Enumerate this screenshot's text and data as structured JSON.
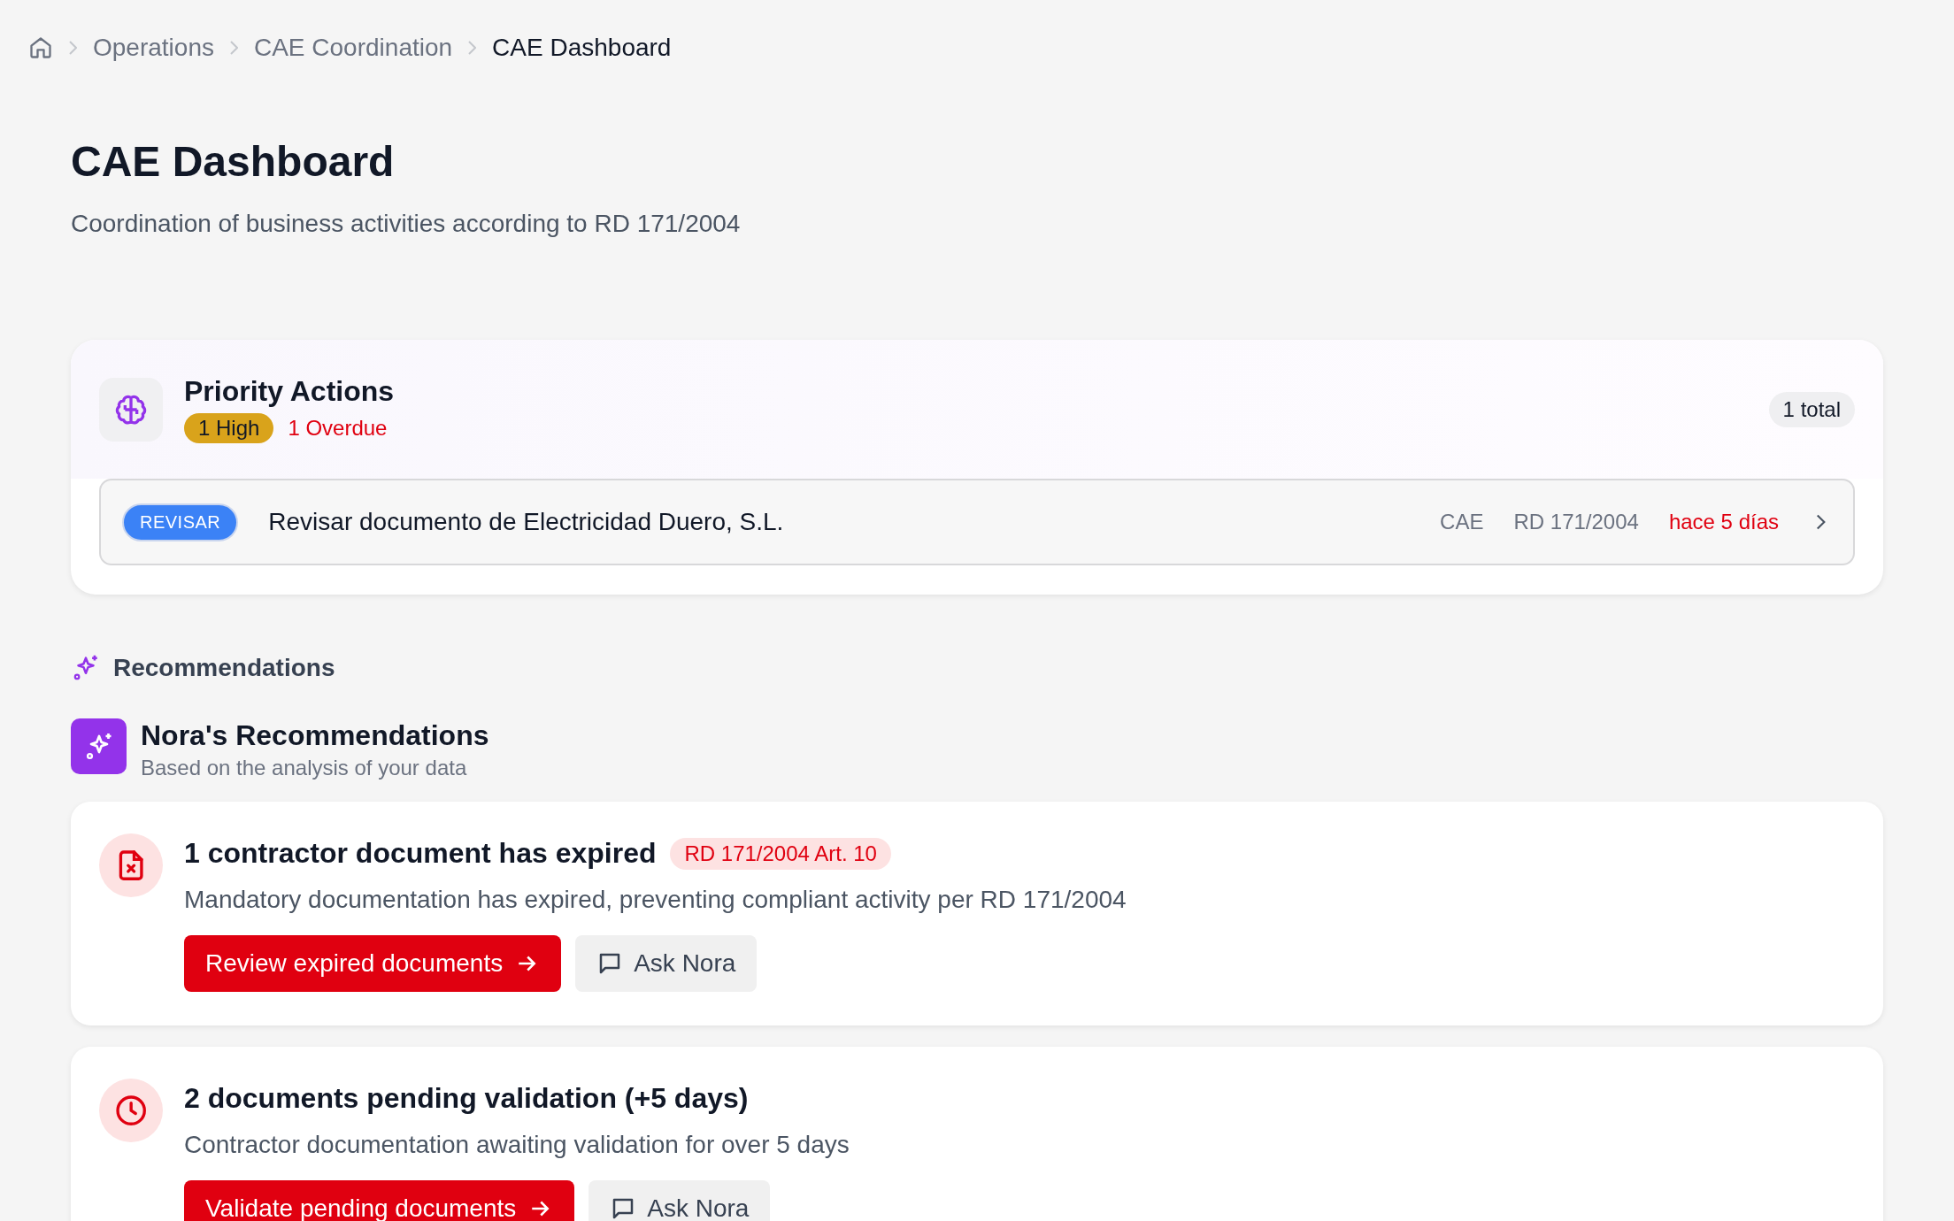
{
  "breadcrumb": [
    {
      "label": "Operations",
      "current": false
    },
    {
      "label": "CAE Coordination",
      "current": false
    },
    {
      "label": "CAE Dashboard",
      "current": true
    }
  ],
  "page": {
    "title": "CAE Dashboard",
    "subtitle": "Coordination of business activities according to RD 171/2004"
  },
  "priority_actions": {
    "title": "Priority Actions",
    "total": "1 total",
    "badges": [
      {
        "kind": "high",
        "text": "1 High"
      },
      {
        "kind": "overdue",
        "text": "1 Overdue"
      }
    ],
    "items": [
      {
        "tag": "REVISAR",
        "title": "Revisar documento de Electricidad Duero, S.L.",
        "module": "CAE",
        "regulation": "RD 171/2004",
        "age": "hace 5 días"
      }
    ]
  },
  "recommendations": {
    "heading": "Recommendations",
    "title": "Nora's Recommendations",
    "subtitle": "Based on the analysis of your data",
    "items": [
      {
        "kind": "expired",
        "title": "1 contractor document has expired",
        "tag": "RD 171/2004 Art. 10",
        "description": "Mandatory documentation has expired, preventing compliant activity per RD 171/2004",
        "action": "Review expired documents",
        "ask": "Ask Nora"
      },
      {
        "kind": "pending",
        "title": "2 documents pending validation (+5 days)",
        "description": "Contractor documentation awaiting validation for over 5 days",
        "action": "Validate pending documents",
        "ask": "Ask Nora"
      }
    ]
  }
}
